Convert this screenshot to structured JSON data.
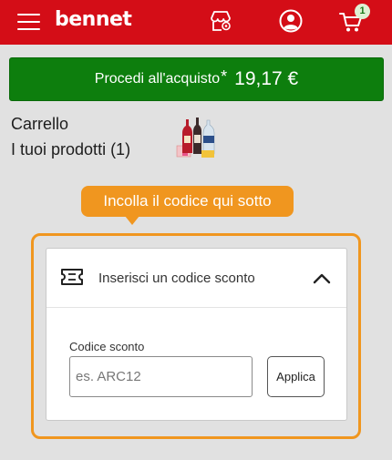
{
  "header": {
    "logo_text": "bennet",
    "cart_count": "1",
    "icons": [
      "menu-icon",
      "store-icon",
      "user-icon",
      "cart-icon"
    ],
    "background_color": "#d40d17"
  },
  "checkout_button": {
    "label": "Procedi all'acquisto",
    "asterisk": "*",
    "price": "19,17 €",
    "color": "#0d7e0d"
  },
  "cart": {
    "title": "Carrello",
    "subtitle": "I tuoi prodotti (1)",
    "thumbnail_icon": "products-thumbnail"
  },
  "tooltip": {
    "text": "Incolla il codice qui sotto",
    "color": "#f0961f"
  },
  "discount_panel": {
    "title": "Inserisci un codice sconto",
    "icon": "ticket-icon",
    "expanded": true,
    "field_label": "Codice sconto",
    "field_value": "",
    "field_placeholder": "es. ARC12",
    "apply_label": "Applica"
  }
}
